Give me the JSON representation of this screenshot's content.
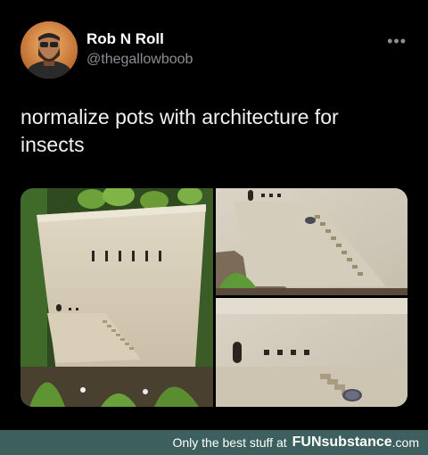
{
  "tweet": {
    "author_name": "Rob N Roll",
    "handle": "@thegallowboob",
    "more_icon": "more-horizontal-icon",
    "text": "normalize pots with architecture for insects"
  },
  "media": {
    "description_icon": "photo-collage",
    "panels": 3
  },
  "footer": {
    "tagline": "Only the best stuff at",
    "brand_name": "FUNsubstance",
    "brand_suffix": ".com"
  }
}
